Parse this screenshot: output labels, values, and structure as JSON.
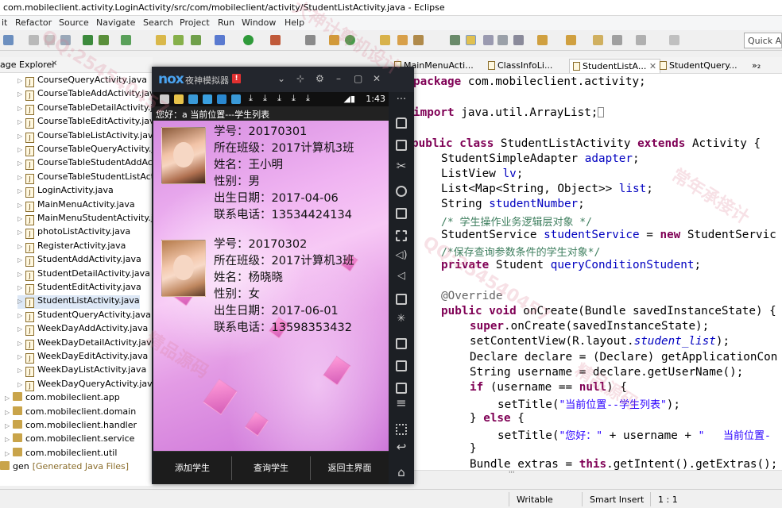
{
  "window": {
    "title": "com.mobileclient.activity.LoginActivity/src/com/mobileclient/activity/StudentListActivity.java - Eclipse"
  },
  "menu": [
    "it",
    "Refactor",
    "Source",
    "Navigate",
    "Search",
    "Project",
    "Run",
    "Window",
    "Help"
  ],
  "toolbar": {
    "quick_access": "Quick Ac"
  },
  "package_explorer": {
    "title": "age Explorer",
    "close": "✕",
    "files": [
      "CourseQueryActivity.java",
      "CourseTableAddActivity.java",
      "CourseTableDetailActivity.java",
      "CourseTableEditActivity.java",
      "CourseTableListActivity.java",
      "CourseTableQueryActivity.java",
      "CourseTableStudentAddActivity",
      "CourseTableStudentListActivity",
      "LoginActivity.java",
      "MainMenuActivity.java",
      "MainMenuStudentActivity.java",
      "photoListActivity.java",
      "RegisterActivity.java",
      "StudentAddActivity.java",
      "StudentDetailActivity.java",
      "StudentEditActivity.java",
      "StudentListActivity.java",
      "StudentQueryActivity.java",
      "WeekDayAddActivity.java",
      "WeekDayDetailActivity.java",
      "WeekDayEditActivity.java",
      "WeekDayListActivity.java",
      "WeekDayQueryActivity.java"
    ],
    "packages": [
      "com.mobileclient.app",
      "com.mobileclient.domain",
      "com.mobileclient.handler",
      "com.mobileclient.service",
      "com.mobileclient.util"
    ],
    "gen_label": "gen",
    "gen_note": "[Generated Java Files]"
  },
  "editor_tabs": [
    "MainMenuActi...",
    "ClassInfoLi...",
    "StudentListA...",
    "StudentQuery...",
    "»₂"
  ],
  "code": {
    "l1_kw": "package",
    "l1_rest": " com.mobileclient.activity;",
    "l2_kw": "import",
    "l2_rest": " java.util.ArrayList;",
    "l3_kw1": "public",
    "l3_kw2": " class",
    "l3_name": " StudentListActivity ",
    "l3_kw3": "extends",
    "l3_rest": " Activity {",
    "l4_type": "StudentSimpleAdapter ",
    "l4_field": "adapter",
    "l4_end": ";",
    "l5_type": "ListView ",
    "l5_field": "lv",
    "l5_end": ";",
    "l6_type": "List<Map<String, Object>> ",
    "l6_field": "list",
    "l6_end": ";",
    "l7_type": "String ",
    "l7_field": "studentNumber",
    "l7_end": ";",
    "l8": "/* 学生操作业务逻辑层对象 */",
    "l9_type": "StudentService ",
    "l9_field": "studentService",
    "l9_mid": " = ",
    "l9_kw": "new",
    "l9_rest": " StudentServic",
    "l10": "/*保存查询参数条件的学生对象*/",
    "l11_kw": "private",
    "l11_type": " Student ",
    "l11_field": "queryConditionStudent",
    "l11_end": ";",
    "l12": "@Override",
    "l13_kw1": "public",
    "l13_kw2": " void",
    "l13_rest": " onCreate(Bundle savedInstanceState) {",
    "l14_kw": "super",
    "l14_rest": ".onCreate(savedInstanceState);",
    "l15_a": "setContentView(R.layout.",
    "l15_it": "student_list",
    "l15_b": ");",
    "l16": "Declare declare = (Declare) getApplicationCon",
    "l17": "String username = declare.getUserName();",
    "l18_kw": "if",
    "l18_a": " (username == ",
    "l18_kw2": "null",
    "l18_b": ") {",
    "l19_a": "setTitle(",
    "l19_str": "\"当前位置--学生列表\"",
    "l19_b": ");",
    "l20_a": "} ",
    "l20_kw": "else",
    "l20_b": " {",
    "l21_a": "setTitle(",
    "l21_str": "\"您好：\"",
    "l21_b": " + username + ",
    "l21_str2": "\"   当前位置-",
    "l22": "}",
    "l23_a": "Bundle extras = ",
    "l23_kw": "this",
    "l23_b": ".getIntent().getExtras();"
  },
  "editor_scroll_label": "'''",
  "status_bar": {
    "writable": "Writable",
    "insert_mode": "Smart Insert",
    "position": "1 : 1"
  },
  "emulator": {
    "logo": "nox",
    "name": "夜神模拟器",
    "badge": "!",
    "time": "1:43",
    "action_title": "您好：a  当前位置---学生列表",
    "students": [
      {
        "number_label": "学号：",
        "number": "20170301",
        "class_label": "所在班级：",
        "class": "2017计算机3班",
        "name_label": "姓名：",
        "name": "王小明",
        "gender_label": "性别：",
        "gender": "男",
        "birth_label": "出生日期：",
        "birth": "2017-04-06",
        "phone_label": "联系电话：",
        "phone": "13534424134"
      },
      {
        "number_label": "学号：",
        "number": "20170302",
        "class_label": "所在班级：",
        "class": "2017计算机3班",
        "name_label": "姓名：",
        "name": "杨晓晓",
        "gender_label": "性别：",
        "gender": "女",
        "birth_label": "出生日期：",
        "birth": "2017-06-01",
        "phone_label": "联系电话：",
        "phone": "13598353432"
      }
    ],
    "buttons": [
      "添加学生",
      "查询学生",
      "返回主界面"
    ]
  },
  "watermarks": [
    "QQ:254540457",
    "常年承接计",
    "精品源码",
    "大神计算机设计"
  ],
  "colors": {
    "keyword": "#7f0055",
    "field": "#0000c0",
    "comment": "#3f7f5f",
    "string": "#2a00ff",
    "emulator_accent": "#4aa3f0",
    "list_background": "#e8a6ea"
  }
}
